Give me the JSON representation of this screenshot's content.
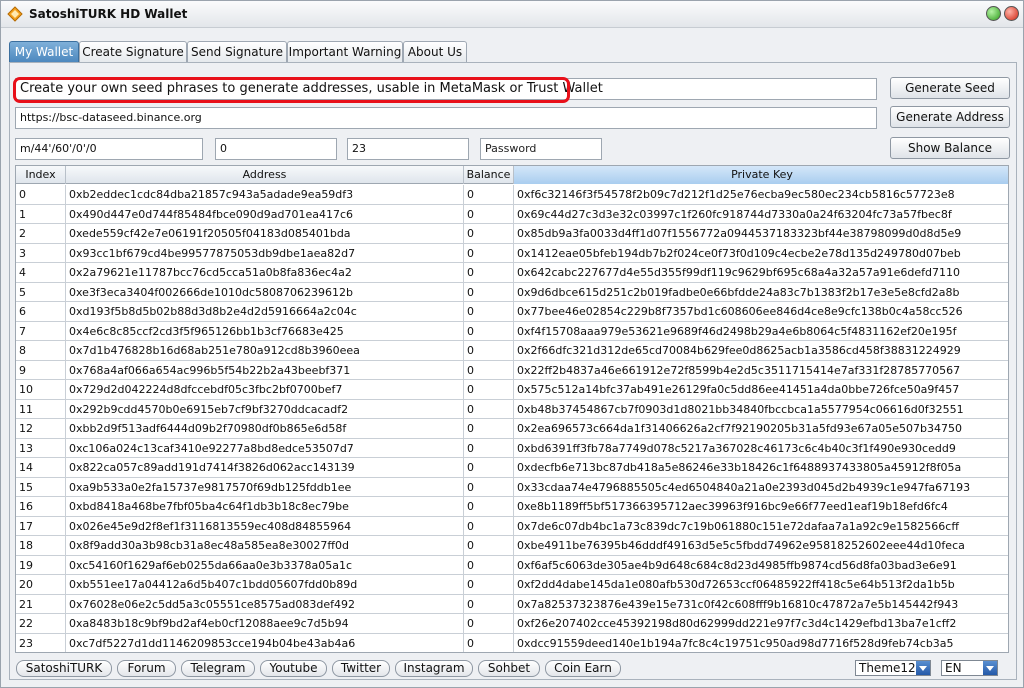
{
  "window": {
    "title": "SatoshiTURK HD Wallet"
  },
  "tabs": [
    {
      "label": "My Wallet"
    },
    {
      "label": "Create Signature"
    },
    {
      "label": "Send Signature"
    },
    {
      "label": "Important Warning"
    },
    {
      "label": "About Us"
    }
  ],
  "seed_field": {
    "value": "Create your own seed phrases to generate addresses, usable in MetaMask or Trust Wallet"
  },
  "rpc_field": {
    "value": "https://bsc-dataseed.binance.org"
  },
  "path_field": {
    "value": "m/44'/60'/0'/0"
  },
  "start_field": {
    "value": "0"
  },
  "count_field": {
    "value": "23"
  },
  "password_field": {
    "placeholder": "Password"
  },
  "buttons": {
    "generate_seed": "Generate Seed",
    "generate_address": "Generate Address",
    "show_balance": "Show Balance"
  },
  "table": {
    "columns": [
      "Index",
      "Address",
      "Balance",
      "Private Key"
    ],
    "rows": [
      [
        "0",
        "0xb2eddec1cdc84dba21857c943a5adade9ea59df3",
        "0",
        "0xf6c32146f3f54578f2b09c7d212f1d25e76ecba9ec580ec234cb5816c57723e8"
      ],
      [
        "1",
        "0x490d447e0d744f85484fbce090d9ad701ea417c6",
        "0",
        "0x69c44d27c3d3e32c03997c1f260fc918744d7330a0a24f63204fc73a57fbec8f"
      ],
      [
        "2",
        "0xede559cf42e7e06191f20505f04183d085401bda",
        "0",
        "0x85db9a3fa0033d4ff1d07f1556772a0944537183323bf44e38798099d0d8d5e9"
      ],
      [
        "3",
        "0x93cc1bf679cd4be99577875053db9dbe1aea82d7",
        "0",
        "0x1412eae05bfeb194db7b2f024ce0f73f0d109c4ecbe2e78d135d249780d07beb"
      ],
      [
        "4",
        "0x2a79621e11787bcc76cd5cca51a0b8fa836ec4a2",
        "0",
        "0x642cabc227677d4e55d355f99df119c9629bf695c68a4a32a57a91e6defd7110"
      ],
      [
        "5",
        "0xe3f3eca3404f002666de1010dc5808706239612b",
        "0",
        "0x9d6dbce615d251c2b019fadbe0e66bfdde24a83c7b1383f2b17e3e5e8cfd2a8b"
      ],
      [
        "6",
        "0xd193f5b8d5b02b88d3d8b2e4d2d5916664a2c04c",
        "0",
        "0x77bee46e02854c229b8f7357bd1c608606ee846d4ce8e9cfc138b0c4a58cc526"
      ],
      [
        "7",
        "0x4e6c8c85ccf2cd3f5f965126bb1b3cf76683e425",
        "0",
        "0xf4f15708aaa979e53621e9689f46d2498b29a4e6b8064c5f4831162ef20e195f"
      ],
      [
        "8",
        "0x7d1b476828b16d68ab251e780a912cd8b3960eea",
        "0",
        "0x2f66dfc321d312de65cd70084b629fee0d8625acb1a3586cd458f38831224929"
      ],
      [
        "9",
        "0x768a4af066a654ac996b5f54b22b2a43beebf371",
        "0",
        "0x22ff2b4837a46e661912e72f8599b4e2d5c3511715414e7af331f28785770567"
      ],
      [
        "10",
        "0x729d2d042224d8dfccebdf05c3fbc2bf0700bef7",
        "0",
        "0x575c512a14bfc37ab491e26129fa0c5dd86ee41451a4da0bbe726fce50a9f457"
      ],
      [
        "11",
        "0x292b9cdd4570b0e6915eb7cf9bf3270ddcacadf2",
        "0",
        "0xb48b37454867cb7f0903d1d8021bb34840fbccbca1a5577954c06616d0f32551"
      ],
      [
        "12",
        "0xbb2d9f513adf6444d09b2f70980df0b865e6d58f",
        "0",
        "0x2ea696573c664da1f31406626a2cf7f92190205b31a5fd93e67a05e507b34750"
      ],
      [
        "13",
        "0xc106a024c13caf3410e92277a8bd8edce53507d7",
        "0",
        "0xbd6391ff3fb78a7749d078c5217a367028c46173c6c4b40c3f1f490e930cedd9"
      ],
      [
        "14",
        "0x822ca057c89add191d7414f3826d062acc143139",
        "0",
        "0xdecfb6e713bc87db418a5e86246e33b18426c1f6488937433805a45912f8f05a"
      ],
      [
        "15",
        "0xa9b533a0e2fa15737e9817570f69db125fddb1ee",
        "0",
        "0x33cdaa74e4796885505c4ed6504840a21a0e2393d045d2b4939c1e947fa67193"
      ],
      [
        "16",
        "0xbd8418a468be7fbf05ba4c64f1db3b18c8ec79be",
        "0",
        "0xe8b1189ff5bf517366395712aec39963f916bc9e66f77eed1eaf19b18efd6fc4"
      ],
      [
        "17",
        "0x026e45e9d2f8ef1f3116813559ec408d84855964",
        "0",
        "0x7de6c07db4bc1a73c839dc7c19b061880c151e72dafaa7a1a92c9e1582566cff"
      ],
      [
        "18",
        "0x8f9add30a3b98cb31a8ec48a585ea8e30027ff0d",
        "0",
        "0xbe4911be76395b46dddf49163d5e5c5fbdd74962e95818252602eee44d10feca"
      ],
      [
        "19",
        "0xc54160f1629af6eb0255da66aa0e3b3378a05a1c",
        "0",
        "0xf6af5c6063de305ae4b9d648c684c8d23d4985ffb9874cd56d8fa03bad3e6e91"
      ],
      [
        "20",
        "0xb551ee17a04412a6d5b407c1bdd05607fdd0b89d",
        "0",
        "0xf2dd4dabe145da1e080afb530d72653ccf06485922ff418c5e64b513f2da1b5b"
      ],
      [
        "21",
        "0x76028e06e2c5dd5a3c05551ce8575ad083def492",
        "0",
        "0x7a82537323876e439e15e731c0f42c608fff9b16810c47872a7e5b145442f943"
      ],
      [
        "22",
        "0xa8483b18c9bf9bd2af4eb0cf12088aee9c7d5b94",
        "0",
        "0xf26e207402cce45392198d80d62999dd221e97f7c3d4c1429efbd13ba7e1cff2"
      ],
      [
        "23",
        "0xc7df5227d1dd1146209853cce194b04be43ab4a6",
        "0",
        "0xdcc91559deed140e1b194a7fc8c4c19751c950ad98d7716f528d9feb74cb3a5"
      ]
    ]
  },
  "footer": {
    "links": [
      "SatoshiTURK",
      "Forum",
      "Telegram",
      "Youtube",
      "Twitter",
      "Instagram",
      "Sohbet",
      "Coin Earn"
    ],
    "theme_select": "Theme12",
    "language_select": "EN"
  },
  "colors": {
    "active_tab": "#4a86bd",
    "highlight_border": "#e8101a",
    "minimize_button": "#2f9d1c",
    "close_button": "#cf2410"
  }
}
